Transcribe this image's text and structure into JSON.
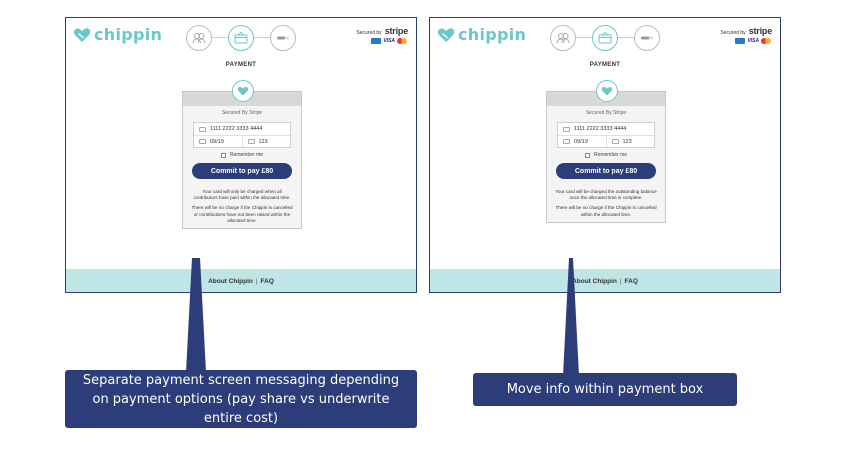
{
  "brand": {
    "name": "chippin",
    "color": "#6bc7c9"
  },
  "accent": "#2c3d7a",
  "footer_bg": "#bfe5e6",
  "screens": [
    {
      "steps": [
        "people-icon",
        "card-icon",
        "progress-icon"
      ],
      "active_step": 2,
      "secured_by": "Secured by",
      "stripe_label": "stripe",
      "card_brands": [
        "AMEX",
        "VISA",
        "mastercard"
      ],
      "page_title": "PAYMENT",
      "payment_box": {
        "secured_text": "Secured By Stripe",
        "card_number": "1111 2222 3333 4444",
        "expiry": "09/19",
        "cvc": "123",
        "remember_label": "Remember me",
        "commit_label": "Commit to pay £80",
        "notes": [
          "Your card will only be charged when all contributors have paid within the allocated time.",
          "There will be no charge if the Chippin is cancelled or contributions have not been raised within the allocated time."
        ]
      },
      "footer": {
        "about": "About Chippin",
        "separator": "|",
        "faq": "FAQ"
      }
    },
    {
      "steps": [
        "people-icon",
        "card-icon",
        "progress-icon"
      ],
      "active_step": 2,
      "secured_by": "Secured by",
      "stripe_label": "stripe",
      "card_brands": [
        "AMEX",
        "VISA",
        "mastercard"
      ],
      "page_title": "PAYMENT",
      "payment_box": {
        "secured_text": "Secured By Stripe",
        "card_number": "1111 2222 3333 4444",
        "expiry": "09/19",
        "cvc": "123",
        "remember_label": "Remember me",
        "commit_label": "Commit to pay £80",
        "notes": [
          "Your card will be charged the outstanding balance once the allocated time is complete.",
          "There will be no charge if the Chippin is cancelled within the allocated time."
        ]
      },
      "footer": {
        "about": "About Chippin",
        "separator": "|",
        "faq": "FAQ"
      }
    }
  ],
  "callouts": [
    {
      "text": "Separate payment screen messaging depending on payment options (pay share vs underwrite entire cost)"
    },
    {
      "text": "Move info within payment box"
    }
  ]
}
